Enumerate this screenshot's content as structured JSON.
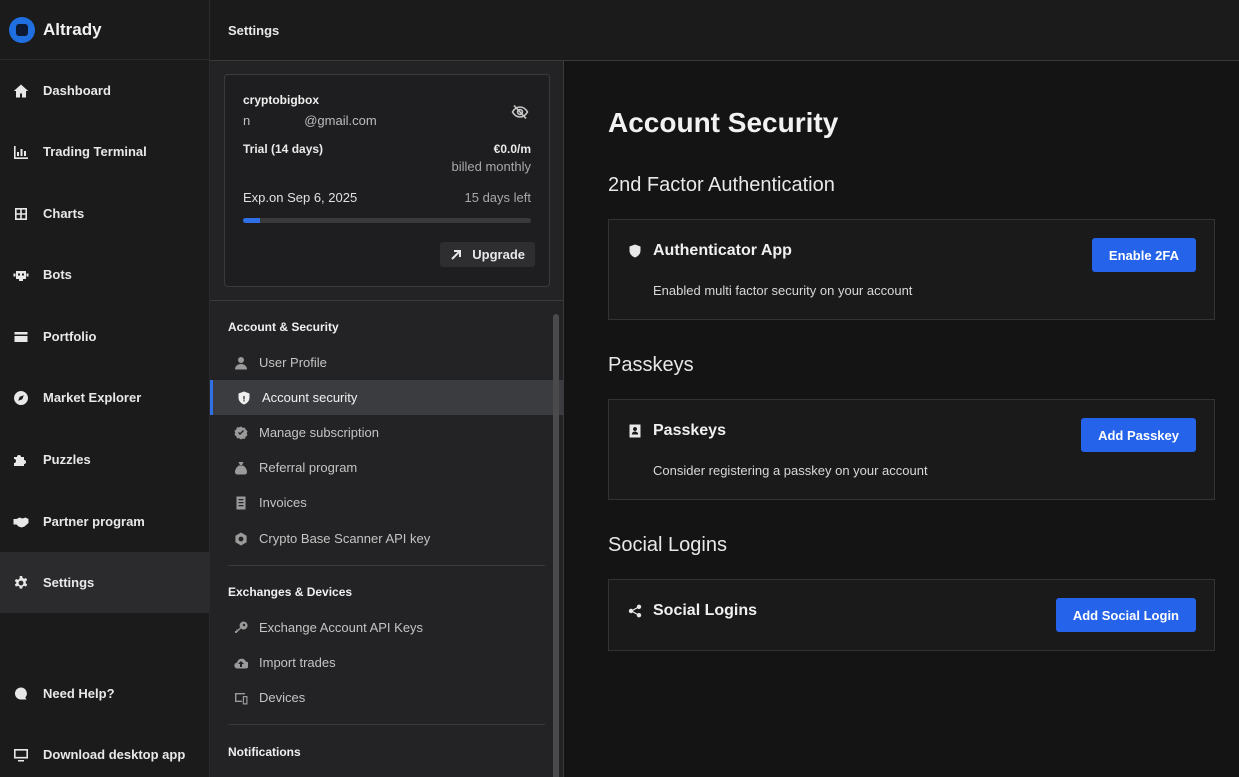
{
  "app": {
    "name": "Altrady",
    "accent": "#2563eb"
  },
  "nav": {
    "items": [
      {
        "label": "Dashboard",
        "icon": "home-icon"
      },
      {
        "label": "Trading Terminal",
        "icon": "bar-chart-icon"
      },
      {
        "label": "Charts",
        "icon": "grid-icon"
      },
      {
        "label": "Bots",
        "icon": "robot-icon"
      },
      {
        "label": "Portfolio",
        "icon": "wallet-icon"
      },
      {
        "label": "Market Explorer",
        "icon": "compass-icon"
      },
      {
        "label": "Puzzles",
        "icon": "puzzle-icon"
      },
      {
        "label": "Partner program",
        "icon": "handshake-icon"
      },
      {
        "label": "Settings",
        "icon": "gear-icon",
        "active": true
      }
    ],
    "help": "Need Help?",
    "download": "Download desktop app"
  },
  "topbar": {
    "title": "Settings"
  },
  "account_card": {
    "username": "cryptobigbox",
    "email_prefix": "n",
    "email_domain": "@gmail.com",
    "plan": "Trial (14 days)",
    "price": "€0.0/m",
    "billing": "billed monthly",
    "expiry": "Exp.on Sep 6, 2025",
    "days_left": "15 days left",
    "progress": 0.06,
    "upgrade_label": "Upgrade"
  },
  "settings_menu": {
    "account_header": "Account & Security",
    "account_items": [
      {
        "label": "User Profile",
        "icon": "user-icon"
      },
      {
        "label": "Account security",
        "icon": "shield-icon",
        "active": true
      },
      {
        "label": "Manage subscription",
        "icon": "badge-check-icon"
      },
      {
        "label": "Referral program",
        "icon": "money-bag-icon"
      },
      {
        "label": "Invoices",
        "icon": "receipt-icon"
      },
      {
        "label": "Crypto Base Scanner API key",
        "icon": "cog-icon"
      }
    ],
    "exchanges_header": "Exchanges & Devices",
    "exchanges_items": [
      {
        "label": "Exchange Account API Keys",
        "icon": "key-icon"
      },
      {
        "label": "Import trades",
        "icon": "cloud-upload-icon"
      },
      {
        "label": "Devices",
        "icon": "devices-icon"
      }
    ],
    "notifications_header": "Notifications"
  },
  "main": {
    "title": "Account Security",
    "sections": [
      {
        "heading": "2nd Factor Authentication",
        "panel_title": "Authenticator App",
        "panel_desc": "Enabled multi factor security on your account",
        "button": "Enable 2FA"
      },
      {
        "heading": "Passkeys",
        "panel_title": "Passkeys",
        "panel_desc": "Consider registering a passkey on your account",
        "button": "Add Passkey"
      },
      {
        "heading": "Social Logins",
        "panel_title": "Social Logins",
        "panel_desc": "",
        "button": "Add Social Login"
      }
    ]
  }
}
